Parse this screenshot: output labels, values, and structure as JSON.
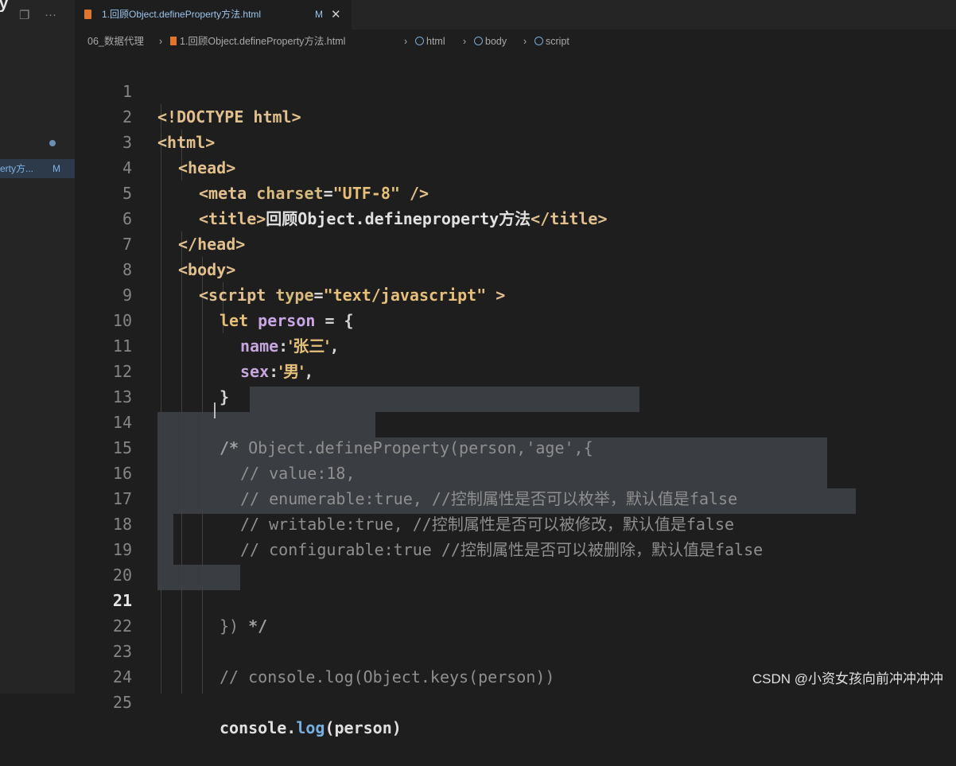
{
  "left_panel": {
    "top_char": "y",
    "file_label": "erty方...",
    "file_badge": "M"
  },
  "tab": {
    "label": "1.回顾Object.defineProperty方法.html",
    "badge": "M",
    "close_glyph": "✕"
  },
  "breadcrumb": {
    "folder": "06_数据代理",
    "file": "1.回顾Object.defineProperty方法.html",
    "items": [
      "html",
      "body",
      "script"
    ]
  },
  "code_lines": [
    {
      "n": "1"
    },
    {
      "n": "2"
    },
    {
      "n": "3"
    },
    {
      "n": "4"
    },
    {
      "n": "5"
    },
    {
      "n": "6"
    },
    {
      "n": "7"
    },
    {
      "n": "8"
    },
    {
      "n": "9"
    },
    {
      "n": "10"
    },
    {
      "n": "11"
    },
    {
      "n": "12"
    },
    {
      "n": "13"
    },
    {
      "n": "14"
    },
    {
      "n": "15"
    },
    {
      "n": "16"
    },
    {
      "n": "17"
    },
    {
      "n": "18"
    },
    {
      "n": "19"
    },
    {
      "n": "20"
    },
    {
      "n": "21"
    },
    {
      "n": "22"
    },
    {
      "n": "23"
    },
    {
      "n": "24"
    },
    {
      "n": "25"
    }
  ],
  "code": {
    "l1": {
      "open": "<!DOCTYPE html>"
    },
    "l2": {
      "open": "<html>"
    },
    "l3": {
      "open": "<head>"
    },
    "l4": {
      "tag": "<meta",
      "attr": "charset",
      "eq": "=",
      "val": "\"UTF-8\"",
      "close": " />"
    },
    "l5": {
      "open": "<title>",
      "text": "回顾Object.defineproperty方法",
      "close": "</title>"
    },
    "l6": {
      "open": "</head>"
    },
    "l7": {
      "open": "<body>"
    },
    "l8": {
      "tag": "<script",
      "attr": "type",
      "eq": "=",
      "val": "\"text/javascript\"",
      "close": " >"
    },
    "l9": {
      "kw": "let",
      "var": "person",
      "rest": "= {"
    },
    "l10": {
      "prop": "name",
      "colon": ":",
      "val": "'张三'",
      "end": ","
    },
    "l11": {
      "prop": "sex",
      "colon": ":",
      "val": "'男'",
      "end": ","
    },
    "l12": {
      "text": "}"
    },
    "l14": {
      "start": "/*",
      "text": "Object.defineProperty(person,'age',{"
    },
    "l15": {
      "text": "// value:18,"
    },
    "l16": {
      "text": "// enumerable:true, //控制属性是否可以枚举，默认值是false"
    },
    "l17": {
      "text": "// writable:true, //控制属性是否可以被修改，默认值是false"
    },
    "l18": {
      "text": "// configurable:true //控制属性是否可以被删除，默认值是false"
    },
    "l21": {
      "text": "})",
      "end": "*/"
    },
    "l23": {
      "text": "// console.log(Object.keys(person))"
    },
    "l25": {
      "obj": "console",
      "dot": ".",
      "fn": "log",
      "args": "(person)"
    }
  },
  "active_line": "21",
  "watermark": "CSDN @小资女孩向前冲冲冲冲",
  "colors": {
    "editor_bg": "#1e1e1e",
    "selection": "#3a3d41",
    "tag": "#e2c08d",
    "comment": "#8f8f8f",
    "function": "#76b0e0",
    "variable": "#c9a7e6"
  }
}
